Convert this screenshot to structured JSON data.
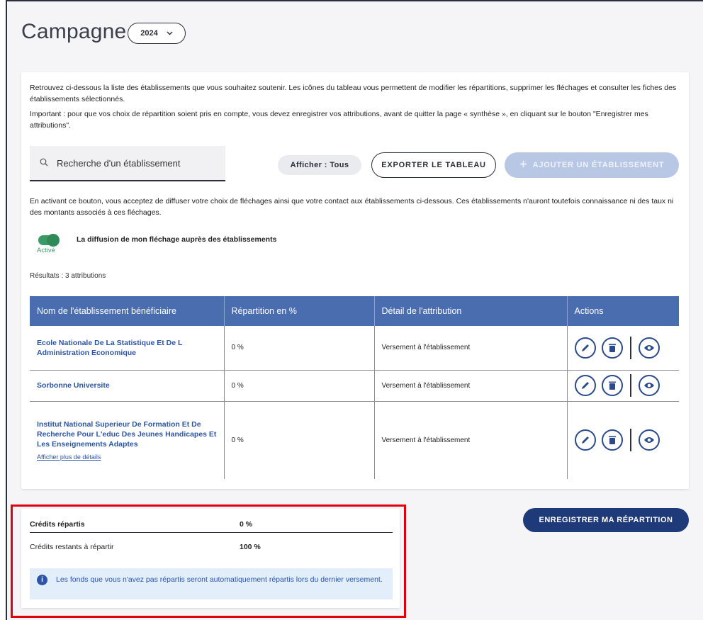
{
  "header": {
    "title": "Campagne",
    "year": "2024"
  },
  "intro": {
    "paragraph1": "Retrouvez ci-dessous la liste des établissements que vous souhaitez soutenir. Les icônes du tableau vous permettent de modifier les répartitions, supprimer les fléchages et consulter les fiches des établissements sélectionnés.",
    "paragraph2": "Important : pour que vos choix de répartition soient pris en compte, vous devez enregistrer vos attributions, avant de quitter la page « synthèse », en cliquant sur le bouton \"Enregistrer mes attributions\"."
  },
  "toolbar": {
    "search_placeholder": "Recherche d'un établissement",
    "filter_label": "Afficher : Tous",
    "export_label": "EXPORTER LE TABLEAU",
    "add_label": "AJOUTER UN ÉTABLISSEMENT"
  },
  "diffusion": {
    "note": "En activant ce bouton, vous acceptez de diffuser votre choix de fléchages ainsi que votre contact aux établissements ci-dessous. Ces établissements n'auront toutefois connaissance ni des taux ni des montants associés à ces fléchages.",
    "toggle_label": "La diffusion de mon fléchage auprès des établissements",
    "toggle_state": "Activé",
    "enabled": true
  },
  "results": "Résultats : 3 attributions",
  "table": {
    "headers": [
      "Nom de l'établissement bénéficiaire",
      "Répartition en %",
      "Détail de l'attribution",
      "Actions"
    ],
    "rows": [
      {
        "name": "Ecole Nationale De La Statistique Et De L Administration Economique",
        "percent": "0 %",
        "detail": "Versement à l'établissement"
      },
      {
        "name": "Sorbonne Universite",
        "percent": "0 %",
        "detail": "Versement à l'établissement"
      },
      {
        "name": "Institut National Superieur De Formation Et De Recherche Pour L'educ Des Jeunes Handicapes Et Les Enseignements Adaptes",
        "percent": "0 %",
        "detail": "Versement à l'établissement",
        "more_link": "Afficher plus de détails"
      }
    ]
  },
  "summary": {
    "credits_allocated_label": "Crédits répartis",
    "credits_allocated_value": "0 %",
    "credits_remaining_label": "Crédits restants à répartir",
    "credits_remaining_value": "100 %",
    "info": "Les fonds que vous n'avez pas répartis seront automatiquement répartis lors du dernier versement."
  },
  "save_button": "ENREGISTRER MA RÉPARTITION",
  "colors": {
    "primary": "#1f3a78",
    "table_header": "#4a6db0",
    "link": "#2c55a5",
    "toggle_on": "#3a9b66",
    "highlight": "#e0000d",
    "info_bg": "#e2eef9"
  }
}
